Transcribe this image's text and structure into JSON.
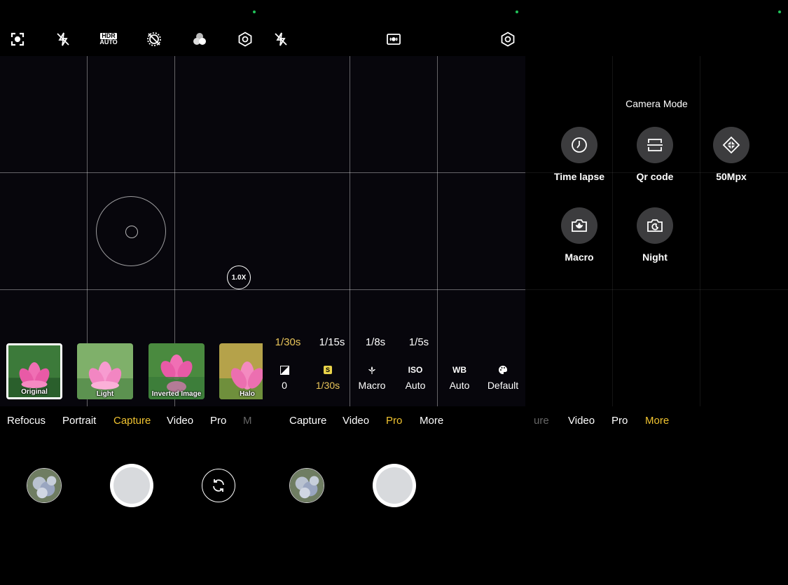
{
  "screens": [
    {
      "id": "capture",
      "top_icons": [
        "focus-lens-icon",
        "flash-off-icon",
        "hdr-auto-icon",
        "live-photo-off-icon",
        "filter-icon",
        "settings-icon"
      ],
      "hdr": {
        "line1": "HDR",
        "line2": "AUTO"
      },
      "zoom": "1.0X",
      "filters": [
        {
          "label": "Original",
          "selected": true
        },
        {
          "label": "Light",
          "selected": false
        },
        {
          "label": "Inverted Image",
          "selected": false
        },
        {
          "label": "Halo",
          "selected": false
        }
      ],
      "modes": [
        "Refocus",
        "Portrait",
        "Capture",
        "Video",
        "Pro",
        "M"
      ],
      "active_mode": "Capture"
    },
    {
      "id": "pro",
      "top_icons": [
        "flash-off-icon",
        "metering-icon",
        "settings-icon"
      ],
      "shutter_speeds": [
        "1/30s",
        "1/15s",
        "1/8s",
        "1/5s"
      ],
      "active_shutter": "1/30s",
      "pro_controls": [
        {
          "icon": "exposure-icon",
          "icon_text": "",
          "value": "0",
          "active": false
        },
        {
          "icon": "shutter-s-icon",
          "icon_text": "S",
          "value": "1/30s",
          "active": true
        },
        {
          "icon": "focus-macro-icon",
          "icon_text": "",
          "value": "Macro",
          "active": false
        },
        {
          "icon": "iso-icon",
          "icon_text": "ISO",
          "value": "Auto",
          "active": false
        },
        {
          "icon": "wb-icon",
          "icon_text": "WB",
          "value": "Auto",
          "active": false
        },
        {
          "icon": "palette-icon",
          "icon_text": "",
          "value": "Default",
          "active": false
        }
      ],
      "modes": [
        "Capture",
        "Video",
        "Pro",
        "More"
      ],
      "active_mode": "Pro"
    },
    {
      "id": "more",
      "title": "Camera Mode",
      "camera_modes": [
        {
          "label": "Time lapse",
          "icon": "timer-icon"
        },
        {
          "label": "Qr code",
          "icon": "qr-scan-icon"
        },
        {
          "label": "50Mpx",
          "icon": "diamond-grid-icon"
        },
        {
          "label": "Macro",
          "icon": "macro-flower-icon"
        },
        {
          "label": "Night",
          "icon": "night-moon-icon"
        }
      ],
      "modes": [
        "ure",
        "Video",
        "Pro",
        "More"
      ],
      "active_mode": "More"
    }
  ],
  "colors": {
    "accent": "#f0c330",
    "status_dot": "#20c35a",
    "viewfinder": "#07060c"
  }
}
